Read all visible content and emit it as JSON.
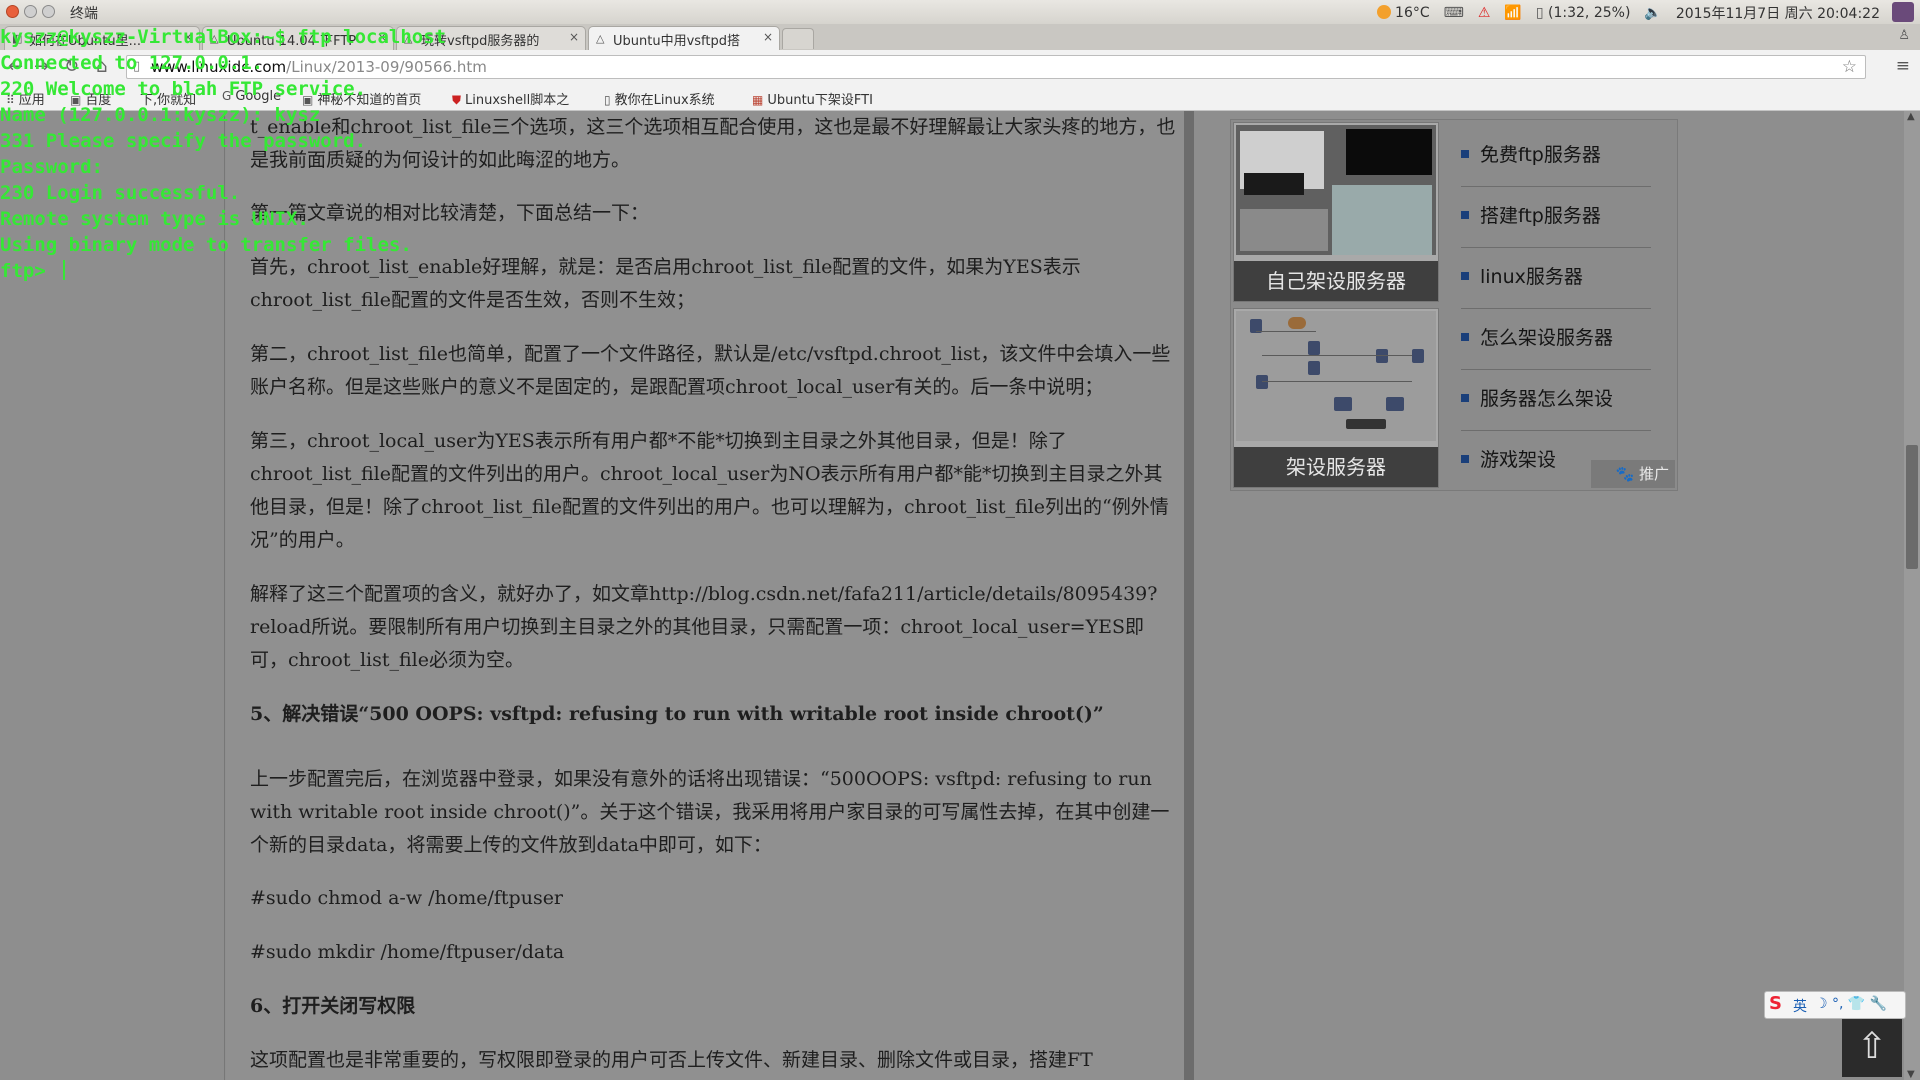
{
  "system": {
    "title": "终端",
    "weather": "16°C",
    "battery": "(1:32, 25%)",
    "datetime": "2015年11月7日 周六 20:04:22"
  },
  "tabs": [
    {
      "label": "如何在Ubuntu里..."
    },
    {
      "label": "Ubuntu 14.04 下FTP"
    },
    {
      "label": "玩转vsftpd服务器的"
    },
    {
      "label": "Ubuntu中用vsftpd搭"
    }
  ],
  "address": {
    "host": "www.linuxidc.com",
    "path": "/Linux/2013-09/90566.htm"
  },
  "bookmarks": [
    {
      "label": "应用"
    },
    {
      "label": "百度"
    },
    {
      "label": "下,你就知"
    },
    {
      "label": "Google"
    },
    {
      "label": "神秘不知道的首页"
    },
    {
      "label": "Linuxshell脚本之"
    },
    {
      "label": "教你在Linux系统"
    },
    {
      "label": "Ubuntu下架设FTI"
    }
  ],
  "terminal": {
    "lines": [
      "kyszz@kyszz-VirtualBox:~$ ftp localhost",
      "Connected to 127.0.0.1.",
      "220 Welcome to blah FTP service.",
      "Name (127.0.0.1:kyszz): kysz",
      "331 Please specify the password.",
      "Password:",
      "230 Login successful.",
      "Remote system type is UNIX.",
      "Using binary mode to transfer files.",
      "ftp> "
    ]
  },
  "article": {
    "p0": "t_enable和chroot_list_file三个选项，这三个选项相互配合使用，这也是最不好理解最让大家头疼的地方，也是我前面质疑的为何设计的如此晦涩的地方。",
    "p1": "第一篇文章说的相对比较清楚，下面总结一下：",
    "p2": "首先，chroot_list_enable好理解，就是：是否启用chroot_list_file配置的文件，如果为YES表示chroot_list_file配置的文件是否生效，否则不生效；",
    "p3": "第二，chroot_list_file也简单，配置了一个文件路径，默认是/etc/vsftpd.chroot_list，该文件中会填入一些账户名称。但是这些账户的意义不是固定的，是跟配置项chroot_local_user有关的。后一条中说明；",
    "p4": "第三，chroot_local_user为YES表示所有用户都*不能*切换到主目录之外其他目录，但是！除了chroot_list_file配置的文件列出的用户。chroot_local_user为NO表示所有用户都*能*切换到主目录之外其他目录，但是！除了chroot_list_file配置的文件列出的用户。也可以理解为，chroot_list_file列出的“例外情况”的用户。",
    "p5": "解释了这三个配置项的含义，就好办了，如文章http://blog.csdn.net/fafa211/article/details/8095439?reload所说。要限制所有用户切换到主目录之外的其他目录，只需配置一项：chroot_local_user=YES即可，chroot_list_file必须为空。",
    "h5": "5、解决错误“500 OOPS: vsftpd: refusing to run with writable root inside chroot()”",
    "p6": "上一步配置完后，在浏览器中登录，如果没有意外的话将出现错误：“500OOPS: vsftpd: refusing to run with writable root inside chroot()”。关于这个错误，我采用将用户家目录的可写属性去掉，在其中创建一个新的目录data，将需要上传的文件放到data中即可，如下：",
    "cmd1": "#sudo chmod a-w /home/ftpuser",
    "cmd2": "#sudo mkdir /home/ftpuser/data",
    "h6": "6、打开关闭写权限",
    "p7": "这项配置也是非常重要的，写权限即登录的用户可否上传文件、新建目录、删除文件或目录，搭建FT"
  },
  "ad": {
    "caption1": "自己架设服务器",
    "caption2": "架设服务器",
    "links": [
      "免费ftp服务器",
      "搭建ftp服务器",
      "linux服务器",
      "怎么架设服务器",
      "服务器怎么架设",
      "游戏架设"
    ],
    "promo": "推广"
  },
  "ime": {
    "label": "英"
  }
}
